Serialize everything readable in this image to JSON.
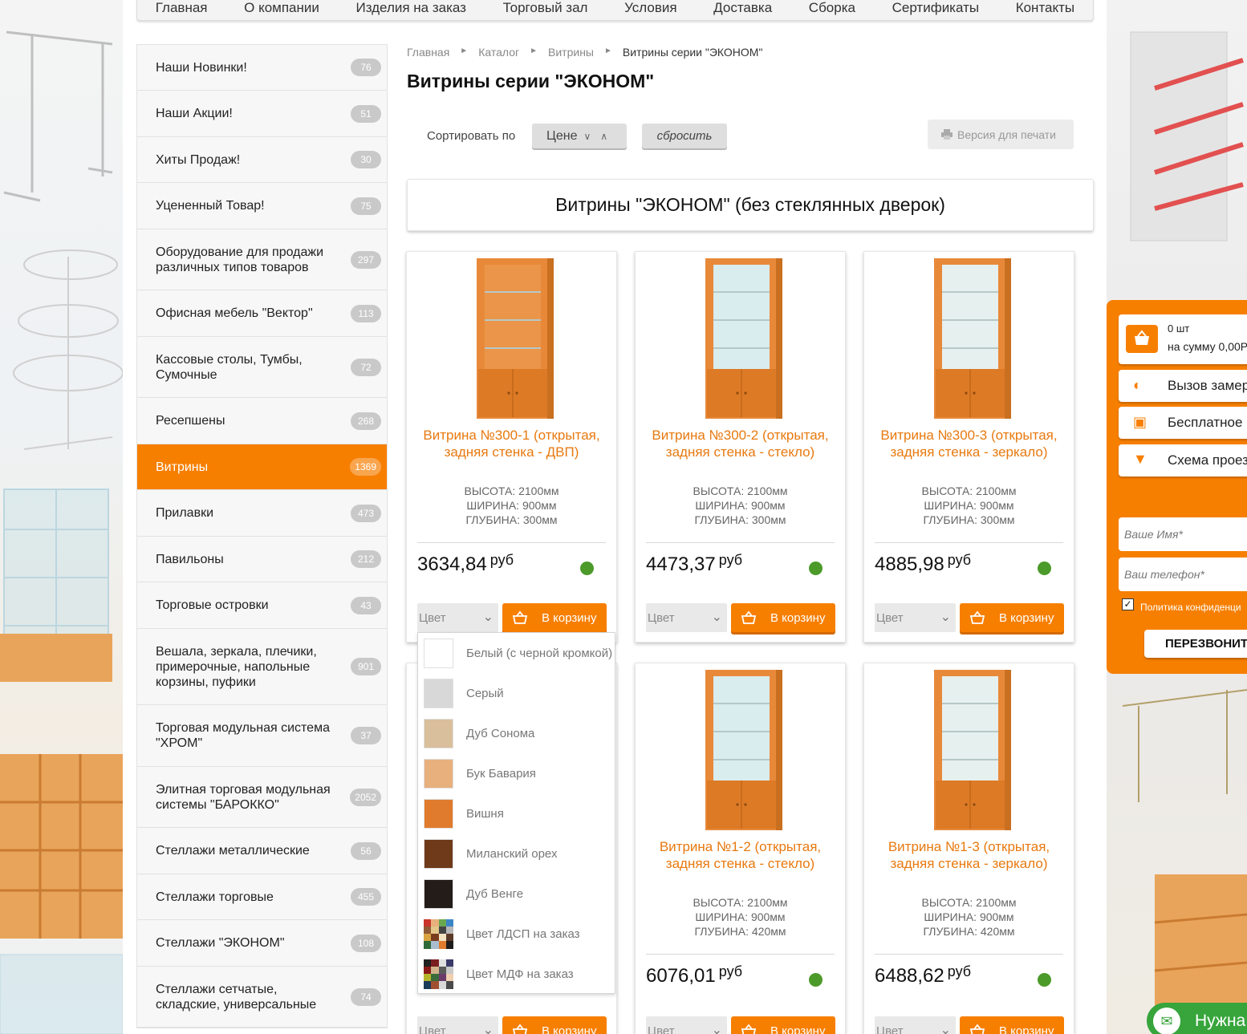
{
  "nav": [
    "Главная",
    "О компании",
    "Изделия на заказ",
    "Торговый зал",
    "Условия",
    "Доставка",
    "Сборка",
    "Сертификаты",
    "Контакты"
  ],
  "sidebar": [
    {
      "label": "Наши Новинки!",
      "count": "76"
    },
    {
      "label": "Наши Акции!",
      "count": "51"
    },
    {
      "label": "Хиты Продаж!",
      "count": "30"
    },
    {
      "label": "Уцененный Товар!",
      "count": "75"
    },
    {
      "label": "Оборудование для продажи различных типов товаров",
      "count": "297"
    },
    {
      "label": "Офисная мебель \"Вектор\"",
      "count": "113"
    },
    {
      "label": "Кассовые столы, Тумбы, Сумочные",
      "count": "72"
    },
    {
      "label": "Ресепшены",
      "count": "268"
    },
    {
      "label": "Витрины",
      "count": "1369",
      "active": true
    },
    {
      "label": "Прилавки",
      "count": "473"
    },
    {
      "label": "Павильоны",
      "count": "212"
    },
    {
      "label": "Торговые островки",
      "count": "43"
    },
    {
      "label": "Вешала, зеркала, плечики, примерочные, напольные корзины, пуфики",
      "count": "901"
    },
    {
      "label": "Торговая модульная система \"ХРОМ\"",
      "count": "37"
    },
    {
      "label": "Элитная торговая модульная системы \"БАРОККО\"",
      "count": "2052"
    },
    {
      "label": "Стеллажи металлические",
      "count": "56"
    },
    {
      "label": "Стеллажи торговые",
      "count": "455"
    },
    {
      "label": "Стеллажи \"ЭКОНОМ\"",
      "count": "108"
    },
    {
      "label": "Стеллажи сетчатые, складские, универсальные",
      "count": "74"
    }
  ],
  "breadcrumb": {
    "items": [
      "Главная",
      "Каталог",
      "Витрины"
    ],
    "current": "Витрины серии \"ЭКОНОМ\"",
    "sep": "►"
  },
  "page_title": "Витрины серии \"ЭКОНОМ\"",
  "sort": {
    "label": "Сортировать по",
    "value": "Цене",
    "reset": "сбросить",
    "print": "Версия для печати"
  },
  "section_title": "Витрины \"ЭКОНОМ\" (без стеклянных дверок)",
  "currency": "руб",
  "color_placeholder": "Цвет",
  "cart_label": "В корзину",
  "products": [
    {
      "name": "Витрина №300-1 (открытая, задняя стенка - ДВП)",
      "height": "ВЫСОТА: 2100мм",
      "width": "ШИРИНА: 900мм",
      "depth": "ГЛУБИНА: 300мм",
      "price": "3634,84"
    },
    {
      "name": "Витрина №300-2 (открытая, задняя стенка - стекло)",
      "height": "ВЫСОТА: 2100мм",
      "width": "ШИРИНА: 900мм",
      "depth": "ГЛУБИНА: 300мм",
      "price": "4473,37"
    },
    {
      "name": "Витрина №300-3 (открытая, задняя стенка - зеркало)",
      "height": "ВЫСОТА: 2100мм",
      "width": "ШИРИНА: 900мм",
      "depth": "ГЛУБИНА: 300мм",
      "price": "4885,98"
    },
    {
      "name": "",
      "height": "",
      "width": "",
      "depth": "",
      "price": ""
    },
    {
      "name": "Витрина №1-2 (открытая, задняя стенка - стекло)",
      "height": "ВЫСОТА: 2100мм",
      "width": "ШИРИНА: 900мм",
      "depth": "ГЛУБИНА: 420мм",
      "price": "6076,01"
    },
    {
      "name": "Витрина №1-3 (открытая, задняя стенка - зеркало)",
      "height": "ВЫСОТА: 2100мм",
      "width": "ШИРИНА: 900мм",
      "depth": "ГЛУБИНА: 420мм",
      "price": "6488,62"
    }
  ],
  "color_options": [
    {
      "label": "Белый (с черной кромкой)",
      "color": "#ffffff"
    },
    {
      "label": "Серый",
      "color": "#d8d8d8"
    },
    {
      "label": "Дуб Сонома",
      "color": "#d9bf9b"
    },
    {
      "label": "Бук Бавария",
      "color": "#e8b07d"
    },
    {
      "label": "Вишня",
      "color": "#e07b2e"
    },
    {
      "label": "Миланский орех",
      "color": "#6e3a1a"
    },
    {
      "label": "Дуб Венге",
      "color": "#231c19"
    },
    {
      "label": "Цвет ЛДСП на заказ",
      "color": "palette"
    },
    {
      "label": "Цвет МДФ на заказ",
      "color": "palette2"
    }
  ],
  "widget": {
    "cart_qty": "0 шт",
    "cart_sum": "на сумму 0,00Р",
    "call_measure": "Вызов замер",
    "free": "Бесплатное",
    "scheme": "Схема проез",
    "name_placeholder": "Ваше Имя*",
    "phone_placeholder": "Ваш телефон*",
    "policy": "Политика конфиденци",
    "callback": "ПЕРЕЗВОНИТ"
  },
  "chat_label": "Нужна",
  "colors": {
    "accent": "#f77f00",
    "product_name": "#e8790f",
    "in_stock": "#4c9a2a"
  }
}
